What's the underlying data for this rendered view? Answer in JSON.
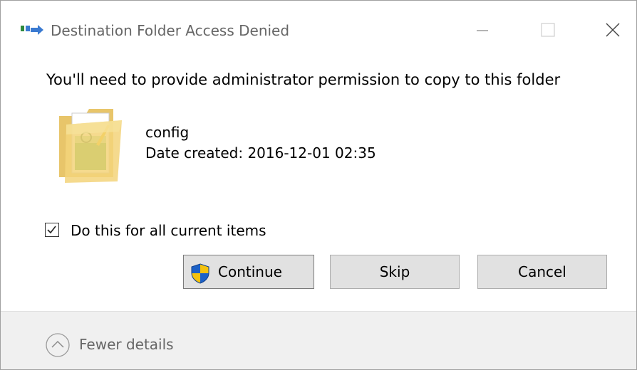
{
  "window": {
    "title": "Destination Folder Access Denied",
    "title_icon": "folder-transfer-icon"
  },
  "titlebar_buttons": [
    "minimize-icon",
    "maximize-icon",
    "close-icon"
  ],
  "message": "You'll need to provide administrator permission to copy to this folder",
  "item": {
    "name": "config",
    "date_created": "Date created: 2016-12-01 02:35",
    "icon": "folder-icon"
  },
  "checkbox": {
    "label": "Do this for all current items",
    "checked": true
  },
  "buttons": {
    "continue": "Continue",
    "skip": "Skip",
    "cancel": "Cancel"
  },
  "details": {
    "label": "Fewer details",
    "icon": "chevron-up-icon"
  },
  "colors": {
    "button_bg": "#e1e1e1",
    "footer_bg": "#f0f0f0",
    "shield_blue": "#1c61c7",
    "shield_yellow": "#f4c20d",
    "folder_yellow": "#f3d37a"
  }
}
